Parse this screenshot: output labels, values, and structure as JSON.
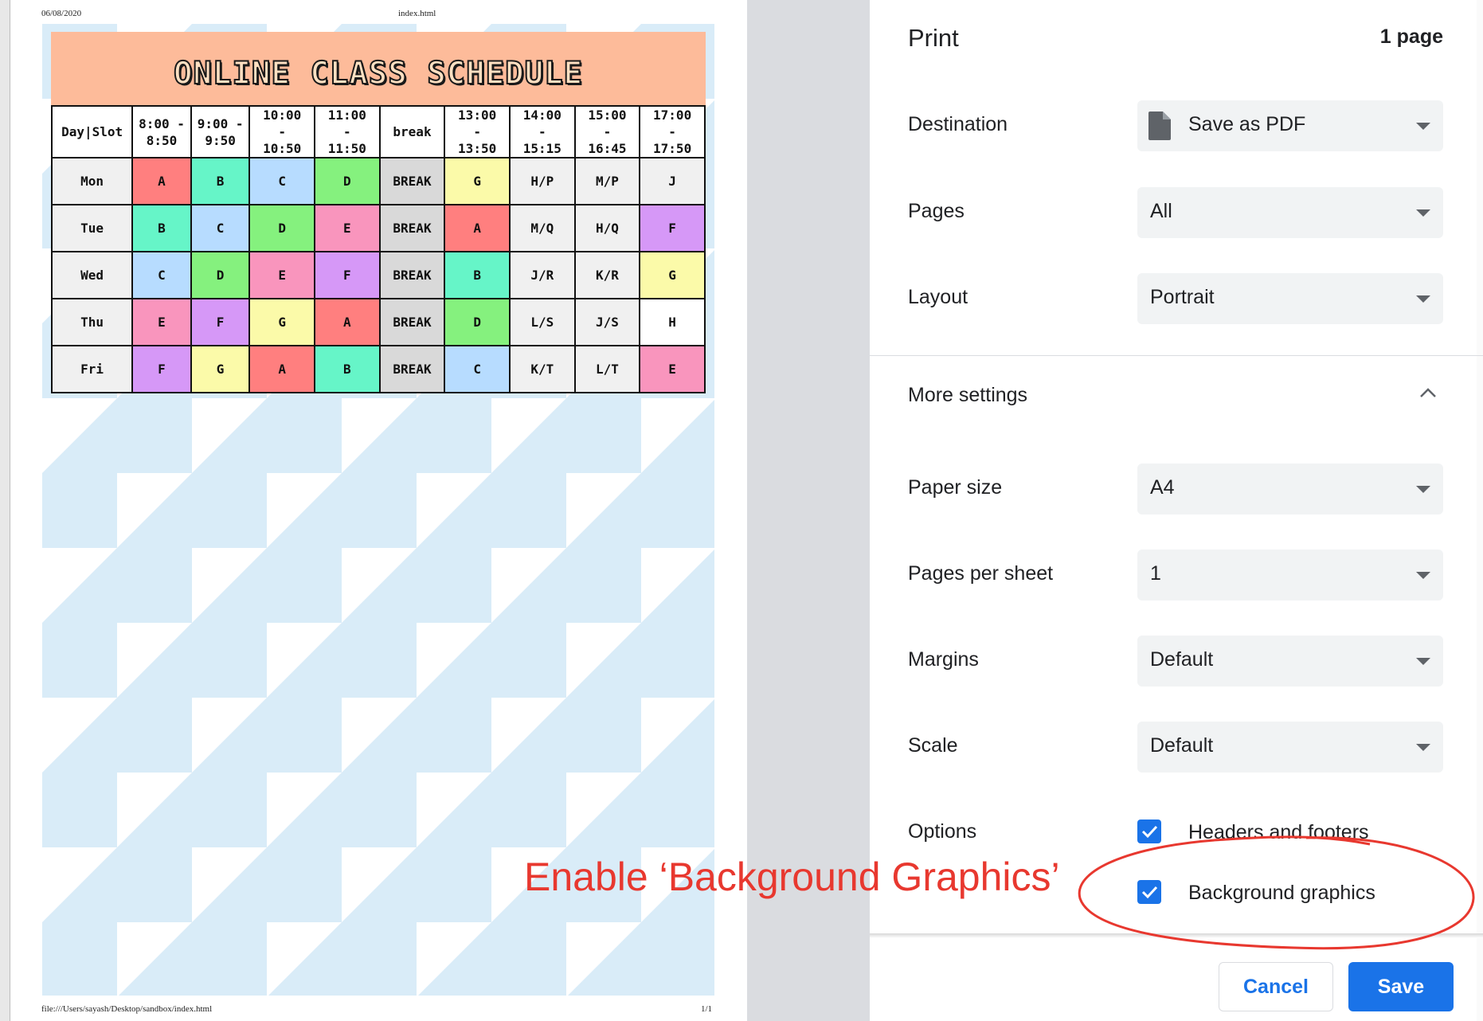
{
  "preview": {
    "header_date": "06/08/2020",
    "header_title": "index.html",
    "footer_url": "file:///Users/sayash/Desktop/sandbox/index.html",
    "footer_pages": "1/1",
    "schedule": {
      "title": "ONLINE CLASS SCHEDULE",
      "columns": [
        "Day|Slot",
        "8:00 -\n8:50",
        "9:00 -\n9:50",
        "10:00\n-\n10:50",
        "11:00\n-\n11:50",
        "break",
        "13:00\n-\n13:50",
        "14:00\n-\n15:15",
        "15:00\n-\n16:45",
        "17:00\n-\n17:50"
      ],
      "rows": [
        [
          "Mon",
          "A",
          "B",
          "C",
          "D",
          "BREAK",
          "G",
          "H/P",
          "M/P",
          "J"
        ],
        [
          "Tue",
          "B",
          "C",
          "D",
          "E",
          "BREAK",
          "A",
          "M/Q",
          "H/Q",
          "F"
        ],
        [
          "Wed",
          "C",
          "D",
          "E",
          "F",
          "BREAK",
          "B",
          "J/R",
          "K/R",
          "G"
        ],
        [
          "Thu",
          "E",
          "F",
          "G",
          "A",
          "BREAK",
          "D",
          "L/S",
          "J/S",
          "H"
        ],
        [
          "Fri",
          "F",
          "G",
          "A",
          "B",
          "BREAK",
          "C",
          "K/T",
          "L/T",
          "E"
        ]
      ],
      "subject_colors": {
        "A": "#ff7f7f",
        "B": "#66f5c8",
        "C": "#b7dcff",
        "D": "#85f17e",
        "E": "#f995bd",
        "F": "#d698f7",
        "G": "#fbfaa9",
        "H": "#ffffff",
        "J": "#f0f0f0",
        "BREAK": "#d9d9d9",
        "day": "#f0f0f0",
        "other": "#f0f0f0"
      },
      "cell_overrides": {
        "Thu-H": "#ffffff"
      },
      "banner_color": "#fdbb9a",
      "pattern_color": "#d9ecf8"
    }
  },
  "panel": {
    "title": "Print",
    "page_count": "1 page",
    "destination": {
      "label": "Destination",
      "value": "Save as PDF",
      "icon": "file-icon"
    },
    "pages": {
      "label": "Pages",
      "value": "All"
    },
    "layout": {
      "label": "Layout",
      "value": "Portrait"
    },
    "more_settings": {
      "label": "More settings",
      "icon": "chevron-up-icon"
    },
    "paper_size": {
      "label": "Paper size",
      "value": "A4"
    },
    "pages_per_sheet": {
      "label": "Pages per sheet",
      "value": "1"
    },
    "margins": {
      "label": "Margins",
      "value": "Default"
    },
    "scale": {
      "label": "Scale",
      "value": "Default"
    },
    "options": {
      "label": "Options",
      "headers_footers": {
        "label": "Headers and footers",
        "checked": true
      },
      "background_graphics": {
        "label": "Background graphics",
        "checked": true
      }
    },
    "cancel_label": "Cancel",
    "save_label": "Save",
    "accent_color": "#1a73e8"
  },
  "annotation": {
    "text": "Enable ‘Background Graphics’",
    "color": "#e8382f"
  }
}
